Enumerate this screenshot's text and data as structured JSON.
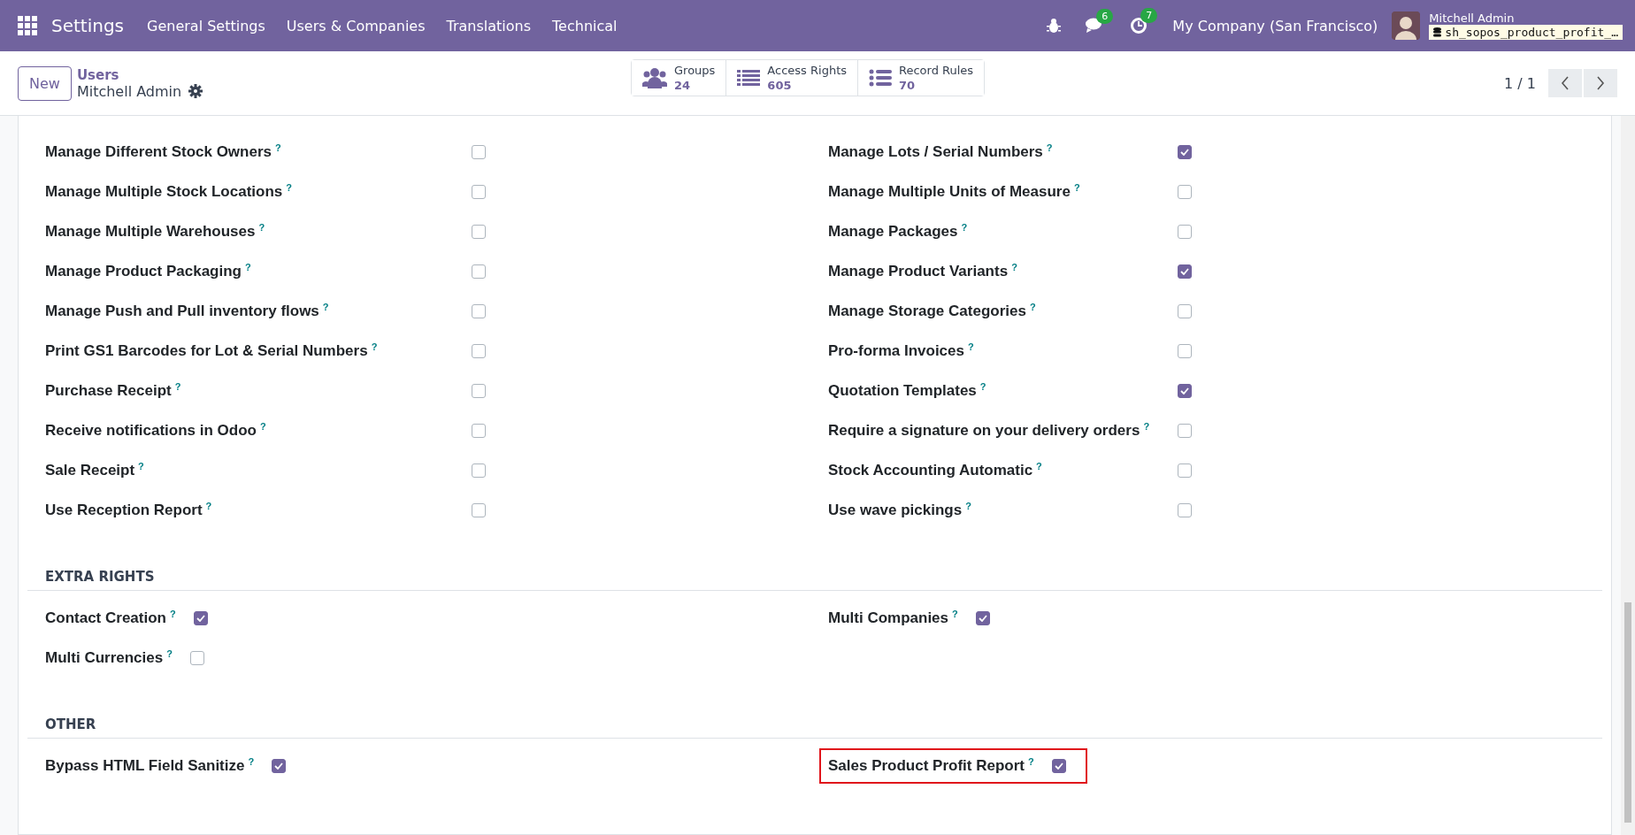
{
  "navbar": {
    "app_name": "Settings",
    "menu": [
      "General Settings",
      "Users & Companies",
      "Translations",
      "Technical"
    ],
    "messages_badge": "6",
    "activities_badge": "7",
    "company": "My Company (San Francisco)",
    "user_name": "Mitchell Admin",
    "database": "sh_sopos_product_profit_…"
  },
  "control_panel": {
    "new_button": "New",
    "breadcrumb": "Users",
    "record_name": "Mitchell Admin",
    "stat_buttons": [
      {
        "label": "Groups",
        "value": "24",
        "kind": "groups"
      },
      {
        "label": "Access Rights",
        "value": "605",
        "kind": "list"
      },
      {
        "label": "Record Rules",
        "value": "70",
        "kind": "bullets"
      }
    ],
    "pager": "1 / 1"
  },
  "sections": [
    {
      "kind": "table",
      "items": [
        {
          "label": "Manage Different Stock Owners",
          "help": "?",
          "checked": false
        },
        {
          "label": "Manage Lots / Serial Numbers",
          "help": "?",
          "checked": true
        },
        {
          "label": "Manage Multiple Stock Locations",
          "help": "?",
          "checked": false
        },
        {
          "label": "Manage Multiple Units of Measure",
          "help": "?",
          "checked": false
        },
        {
          "label": "Manage Multiple Warehouses",
          "help": "?",
          "checked": false
        },
        {
          "label": "Manage Packages",
          "help": "?",
          "checked": false
        },
        {
          "label": "Manage Product Packaging",
          "help": "?",
          "checked": false
        },
        {
          "label": "Manage Product Variants",
          "help": "?",
          "checked": true
        },
        {
          "label": "Manage Push and Pull inventory flows",
          "help": "?",
          "checked": false
        },
        {
          "label": "Manage Storage Categories",
          "help": "?",
          "checked": false
        },
        {
          "label": "Print GS1 Barcodes for Lot & Serial Numbers",
          "help": "?",
          "checked": false
        },
        {
          "label": "Pro-forma Invoices",
          "help": "?",
          "checked": false
        },
        {
          "label": "Purchase Receipt",
          "help": "?",
          "checked": false
        },
        {
          "label": "Quotation Templates",
          "help": "?",
          "checked": true
        },
        {
          "label": "Receive notifications in Odoo",
          "help": "?",
          "checked": false
        },
        {
          "label": "Require a signature on your delivery orders",
          "help": "?",
          "checked": false
        },
        {
          "label": "Sale Receipt",
          "help": "?",
          "checked": false
        },
        {
          "label": "Stock Accounting Automatic",
          "help": "?",
          "checked": false
        },
        {
          "label": "Use Reception Report",
          "help": "?",
          "checked": false
        },
        {
          "label": "Use wave pickings",
          "help": "?",
          "checked": false
        }
      ]
    },
    {
      "kind": "inline",
      "title": "EXTRA RIGHTS",
      "items": [
        {
          "label": "Contact Creation",
          "help": "?",
          "checked": true
        },
        {
          "label": "Multi Companies",
          "help": "?",
          "checked": true
        },
        {
          "label": "Multi Currencies",
          "help": "?",
          "checked": false
        }
      ]
    },
    {
      "kind": "inline",
      "title": "OTHER",
      "items": [
        {
          "label": "Bypass HTML Field Sanitize",
          "help": "?",
          "checked": true,
          "highlighted": false
        },
        {
          "label": "Sales Product Profit Report",
          "help": "?",
          "checked": true,
          "highlighted": true
        }
      ]
    }
  ]
}
